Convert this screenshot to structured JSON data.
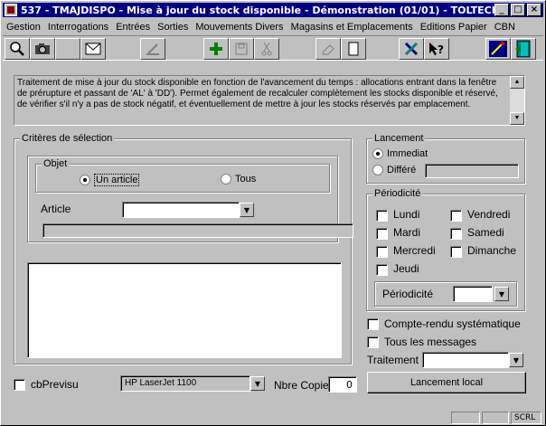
{
  "window": {
    "title": "537 - TMAJDISPO - Mise à jour du stock disponible - Démonstration (01/01) - TOLTECH",
    "minimize": "_",
    "maximize": "□",
    "close": "×"
  },
  "menu": [
    "Gestion",
    "Interrogations",
    "Entrées",
    "Sorties",
    "Mouvements Divers",
    "Magasins et Emplacements",
    "Editions Papier",
    "CBN"
  ],
  "toolbar": {
    "icons": [
      "magnifier-icon",
      "camera-icon",
      "blank",
      "mail-icon",
      "edit-disabled-icon",
      "add-icon",
      "save-disabled-icon",
      "cut-disabled-icon",
      "eraser-disabled-icon",
      "new-page-icon",
      "tools-icon",
      "help-icon",
      "wizard-icon",
      "exit-icon"
    ]
  },
  "description": "Traitement de mise à jour du stock disponible en fonction de l'avancement du temps : allocations entrant dans la fenêtre de prérupture et passant de 'AL' à 'DD'). Permet également de recalculer complètement les stocks disponible et réservé, de vérifier s'il n'y a pas de stock négatif, et éventuellement de mettre à jour les stocks réservés par emplacement.",
  "criteres": {
    "title": "Critères de sélection",
    "objet": {
      "title": "Objet",
      "options": [
        "Un article",
        "Tous"
      ],
      "selected": "Un article"
    },
    "article_label": "Article",
    "article_value": ""
  },
  "lancement": {
    "title": "Lancement",
    "options": [
      "Immediat",
      "Différé"
    ],
    "selected": "Immediat"
  },
  "periodicite": {
    "title": "Périodicité",
    "days_left": [
      "Lundi",
      "Mardi",
      "Mercredi",
      "Jeudi"
    ],
    "days_right": [
      "Vendredi",
      "Samedi",
      "Dimanche"
    ],
    "combo_label": "Périodicité",
    "combo_value": ""
  },
  "options": {
    "compte_rendu": "Compte-rendu systématique",
    "tous_messages": "Tous les messages",
    "traitement_label": "Traitement",
    "traitement_value": ""
  },
  "bottom": {
    "cbprevisu": "cbPrevisu",
    "printer": "HP LaserJet 1100",
    "nbre_copie_label": "Nbre Copie",
    "nbre_copie_value": "0",
    "lancement_button": "Lancement local"
  },
  "status": {
    "scrl": "SCRL"
  }
}
